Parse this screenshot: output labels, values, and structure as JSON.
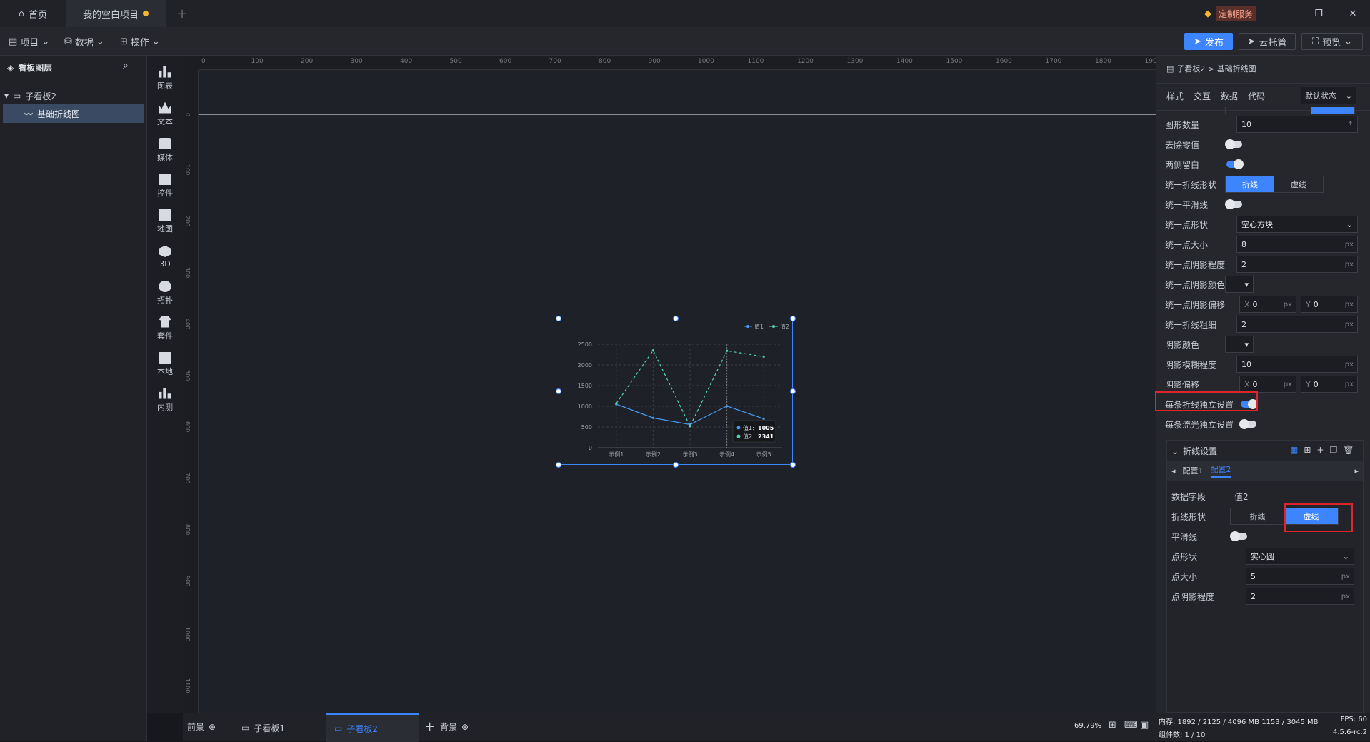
{
  "titlebar": {
    "tabs": [
      {
        "label": "首页"
      },
      {
        "label": "我的空白项目"
      }
    ],
    "custom_service": "定制服务"
  },
  "menubar": {
    "menus": [
      {
        "label": "项目"
      },
      {
        "label": "数据"
      },
      {
        "label": "操作"
      }
    ],
    "publish": "发布",
    "cloud": "云托管",
    "preview": "预览"
  },
  "layers": {
    "title": "看板图层",
    "items": [
      {
        "label": "子看板2"
      },
      {
        "label": "基础折线图"
      }
    ]
  },
  "tools": [
    {
      "label": "图表"
    },
    {
      "label": "文本"
    },
    {
      "label": "媒体"
    },
    {
      "label": "控件"
    },
    {
      "label": "地图"
    },
    {
      "label": "3D"
    },
    {
      "label": "拓扑"
    },
    {
      "label": "套件"
    },
    {
      "label": "本地"
    },
    {
      "label": "内测"
    }
  ],
  "ruler": {
    "top_ticks": [
      "0",
      "100",
      "200",
      "300",
      "400",
      "500",
      "600",
      "700",
      "800",
      "900",
      "1000",
      "1100",
      "1200",
      "1300",
      "1400",
      "1500",
      "1600",
      "1700",
      "1800",
      "1900"
    ],
    "left_ticks": [
      "0",
      "100",
      "200",
      "300",
      "400",
      "500",
      "600",
      "700",
      "800",
      "900",
      "1000",
      "1100"
    ]
  },
  "chart_data": {
    "type": "line",
    "categories": [
      "示例1",
      "示例2",
      "示例3",
      "示例4",
      "示例5"
    ],
    "series": [
      {
        "name": "值1",
        "values": [
          1050,
          720,
          560,
          1005,
          700
        ],
        "style": "solid",
        "color": "#4a9bf0"
      },
      {
        "name": "值2",
        "values": [
          1070,
          2350,
          520,
          2341,
          2200
        ],
        "style": "dashed",
        "color": "#4ed6b0"
      }
    ],
    "yticks": [
      "2500",
      "2000",
      "1500",
      "1000",
      "500",
      "0"
    ],
    "ylim": [
      0,
      2500
    ],
    "grid": true,
    "legend": "top-right",
    "tooltip": {
      "lines": [
        {
          "label": "值1:",
          "value": "1005"
        },
        {
          "label": "值2:",
          "value": "2341"
        }
      ]
    }
  },
  "bottombar": {
    "front": "前景",
    "tabs": [
      {
        "label": "子看板1"
      },
      {
        "label": "子看板2"
      }
    ],
    "background": "背景",
    "zoom": "69.79%"
  },
  "panel": {
    "breadcrumb": "子看板2 > 基础折线图",
    "tabs": [
      {
        "label": "样式"
      },
      {
        "label": "交互"
      },
      {
        "label": "数据"
      },
      {
        "label": "代码"
      }
    ],
    "state": "默认状态",
    "rows": {
      "shape_count": {
        "label": "图形数量",
        "value": "10"
      },
      "remove_zero": {
        "label": "去除零值"
      },
      "both_sides": {
        "label": "两侧留白"
      },
      "line_shape": {
        "label": "统一折线形状",
        "opt1": "折线",
        "opt2": "虚线"
      },
      "smooth": {
        "label": "统一平滑线"
      },
      "point_shape": {
        "label": "统一点形状",
        "value": "空心方块"
      },
      "point_size": {
        "label": "统一点大小",
        "value": "8",
        "unit": "px"
      },
      "point_shadow": {
        "label": "统一点阴影程度",
        "value": "2",
        "unit": "px"
      },
      "point_shadow_color": {
        "label": "统一点阴影颜色"
      },
      "point_shadow_offset": {
        "label": "统一点阴影偏移",
        "x": "0",
        "y": "0",
        "unit": "px"
      },
      "line_width": {
        "label": "统一折线粗细",
        "value": "2",
        "unit": "px"
      },
      "shadow_color": {
        "label": "阴影颜色"
      },
      "shadow_blur": {
        "label": "阴影模糊程度",
        "value": "10",
        "unit": "px"
      },
      "shadow_offset": {
        "label": "阴影偏移",
        "x": "0",
        "y": "0",
        "unit": "px"
      },
      "per_line": {
        "label": "每条折线独立设置"
      },
      "per_flow": {
        "label": "每条流光独立设置"
      }
    },
    "line_settings": {
      "title": "折线设置",
      "configs": [
        {
          "label": "配置1"
        },
        {
          "label": "配置2"
        }
      ],
      "field": {
        "label": "数据字段",
        "value": "值2"
      },
      "shape": {
        "label": "折线形状",
        "opt1": "折线",
        "opt2": "虚线"
      },
      "smooth": {
        "label": "平滑线"
      },
      "point_shape": {
        "label": "点形状",
        "value": "实心圆"
      },
      "point_size": {
        "label": "点大小",
        "value": "5",
        "unit": "px"
      },
      "point_shadow": {
        "label": "点阴影程度",
        "value": "2",
        "unit": "px"
      }
    }
  },
  "status": {
    "memory": "内存: 1892 / 2125 / 4096 MB  1153 / 3045 MB",
    "components": "组件数: 1 / 10",
    "fps": "FPS: 60",
    "version": "4.5.6-rc.2"
  }
}
